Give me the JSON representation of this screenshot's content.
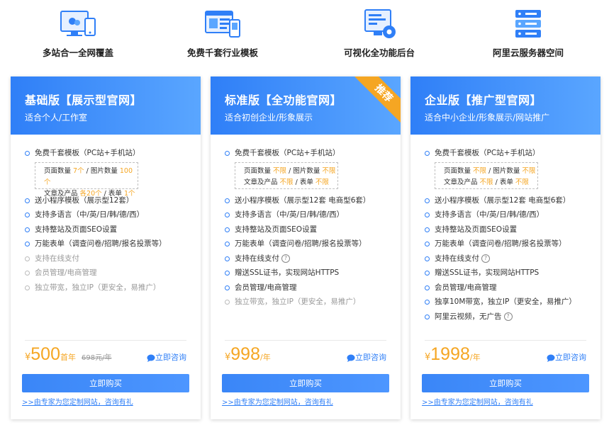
{
  "features": [
    {
      "label": "多站合一全网覆盖",
      "icon": "multi-device-icon"
    },
    {
      "label": "免费千套行业模板",
      "icon": "template-icon"
    },
    {
      "label": "可视化全功能后台",
      "icon": "dashboard-icon"
    },
    {
      "label": "阿里云服务器空间",
      "icon": "server-icon"
    }
  ],
  "plans": [
    {
      "title": "基础版【展示型官网】",
      "subtitle": "适合个人/工作室",
      "items": [
        "免费千套模板（PC站+手机站）",
        "送小程序模板（展示型12套）",
        "支持多语言（中/英/日/韩/德/西）",
        "支持整站及页面SEO设置",
        "万能表单（调查问卷/招聘/报名投票等）",
        "支持在线支付",
        "会员管理/电商管理",
        "独立带宽，独立IP（更安全，易推广）"
      ],
      "sub": {
        "pages_label": "页面数量",
        "pages": "7个",
        "images_label": "图片数量",
        "images": "100个",
        "products_label": "文章及产品",
        "products": "各20个",
        "forms_label": "表单",
        "forms": "1个"
      },
      "currency": "¥",
      "price": "500",
      "unit": "首年",
      "original": "698元/年",
      "consult": "立即咨询",
      "buy": "立即购买",
      "link": ">>由专家为您定制网站，咨询有礼"
    },
    {
      "title": "标准版【全功能官网】",
      "subtitle": "适合初创企业/形象展示",
      "badge": "推荐",
      "items": [
        "免费千套模板（PC站+手机站）",
        "送小程序模板（展示型12套 电商型6套）",
        "支持多语言（中/英/日/韩/德/西）",
        "支持整站及页面SEO设置",
        "万能表单（调查问卷/招聘/报名投票等）",
        "支持在线支付",
        "赠送SSL证书，实现网站HTTPS",
        "会员管理/电商管理",
        "独立带宽，独立IP（更安全，易推广）"
      ],
      "sub": {
        "pages_label": "页面数量",
        "pages": "不限",
        "images_label": "图片数量",
        "images": "不限",
        "products_label": "文章及产品",
        "products": "不限",
        "forms_label": "表单",
        "forms": "不限"
      },
      "currency": "¥",
      "price": "998",
      "unit": "/年",
      "consult": "立即咨询",
      "buy": "立即购买",
      "link": ">>由专家为您定制网站，咨询有礼"
    },
    {
      "title": "企业版【推广型官网】",
      "subtitle": "适合中小企业/形象展示/网站推广",
      "items": [
        "免费千套模板（PC站+手机站）",
        "送小程序模板（展示型12套 电商型6套）",
        "支持多语言（中/英/日/韩/德/西）",
        "支持整站及页面SEO设置",
        "万能表单（调查问卷/招聘/报名投票等）",
        "支持在线支付",
        "赠送SSL证书，实现网站HTTPS",
        "会员管理/电商管理",
        "独享10M带宽，独立IP（更安全，易推广）",
        "阿里云视频，无广告"
      ],
      "sub": {
        "pages_label": "页面数量",
        "pages": "不限",
        "images_label": "图片数量",
        "images": "不限",
        "products_label": "文章及产品",
        "products": "不限",
        "forms_label": "表单",
        "forms": "不限"
      },
      "currency": "¥",
      "price": "1998",
      "unit": "/年",
      "consult": "立即咨询",
      "buy": "立即购买",
      "link": ">>由专家为您定制网站，咨询有礼"
    }
  ],
  "colors": {
    "primary": "#2f7ff7",
    "accent": "#f5a623",
    "muted": "#999999"
  }
}
